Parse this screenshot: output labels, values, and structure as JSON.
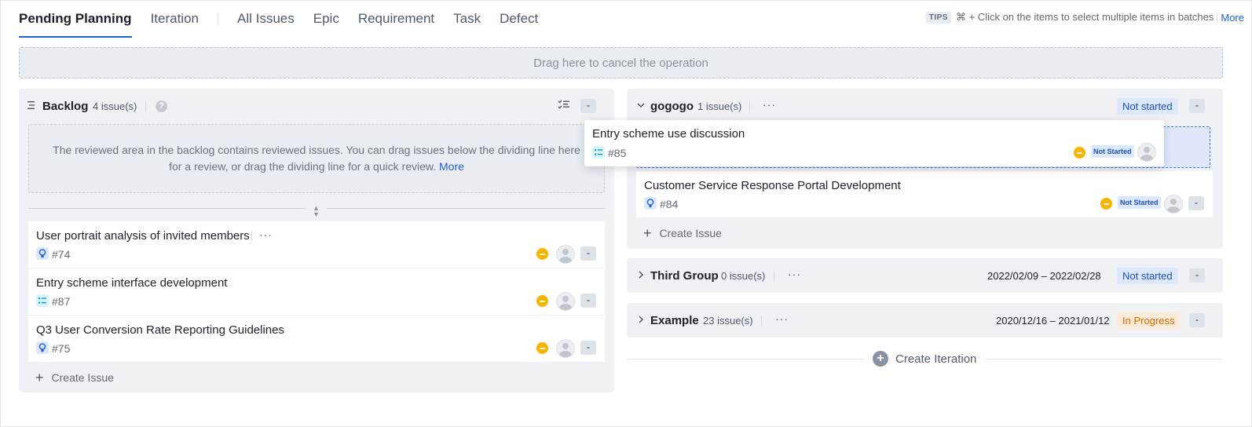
{
  "nav": {
    "tabs": [
      "Pending Planning",
      "Iteration",
      "All Issues",
      "Epic",
      "Requirement",
      "Task",
      "Defect"
    ],
    "tips_badge": "TIPS",
    "tips_text": "⌘ + Click on the items to select multiple items in batches",
    "tips_more": "More"
  },
  "dropzone_text": "Drag here to cancel the operation",
  "backlog": {
    "title": "Backlog",
    "count": "4 issue(s)",
    "help": "?",
    "collapse": "-",
    "review_text": "The reviewed area in the backlog contains reviewed issues. You can drag issues below the dividing line here for a review, or drag the dividing line for a quick review.",
    "review_more": "More",
    "issues": [
      {
        "title": "User portrait analysis of invited members",
        "id": "#74",
        "type": "requirement"
      },
      {
        "title": "Entry scheme interface development",
        "id": "#87",
        "type": "task"
      },
      {
        "title": "Q3 User Conversion Rate Reporting Guidelines",
        "id": "#75",
        "type": "requirement"
      }
    ],
    "create": "Create Issue",
    "more": "···",
    "btn": "-"
  },
  "dragging_card": {
    "title": "Entry scheme use discussion",
    "id": "#85",
    "status": "Not Started"
  },
  "iterations": [
    {
      "name": "gogogo",
      "count": "1 issue(s)",
      "status": "Not started",
      "issues": [
        {
          "title": "Customer Service Response Portal Development",
          "id": "#84",
          "status": "Not Started"
        }
      ],
      "create": "Create Issue"
    },
    {
      "name": "Third Group",
      "count": "0 issue(s)",
      "dates": "2022/02/09 – 2022/02/28",
      "status": "Not started"
    },
    {
      "name": "Example",
      "count": "23 issue(s)",
      "dates": "2020/12/16 – 2021/01/12",
      "status": "In Progress"
    }
  ],
  "create_iteration": "Create Iteration",
  "colors": {
    "accent": "#1f5dd6",
    "priority": "#f7b500",
    "not_started_bg": "#dbe8fd",
    "in_progress_bg": "#fdebd7"
  }
}
